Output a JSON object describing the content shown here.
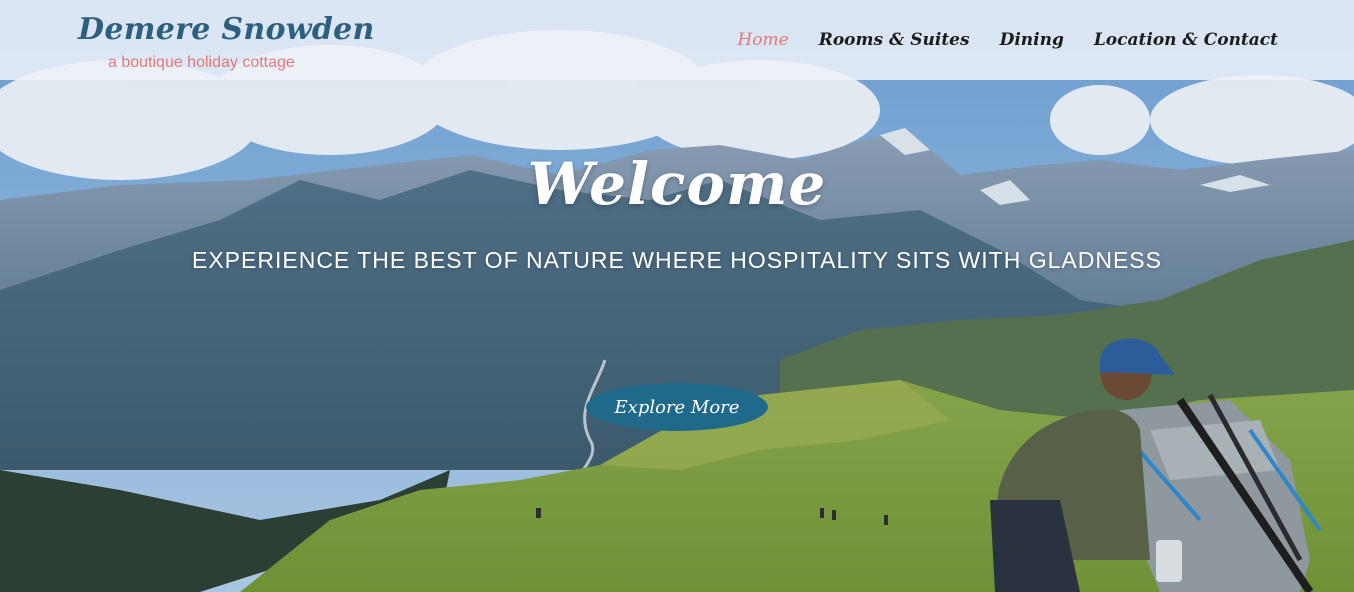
{
  "brand": {
    "name": "Demere Snowden",
    "tagline": "a boutique holiday cottage"
  },
  "nav": {
    "items": [
      {
        "label": "Home",
        "active": true
      },
      {
        "label": "Rooms & Suites",
        "active": false
      },
      {
        "label": "Dining",
        "active": false
      },
      {
        "label": "Location & Contact",
        "active": false
      }
    ]
  },
  "hero": {
    "heading": "Welcome",
    "subheading": "EXPERIENCE THE BEST OF NATURE WHERE HOSPITALITY SITS WITH GLADNESS",
    "cta_label": "Explore More",
    "image": "mountain-landscape-with-hiker"
  },
  "colors": {
    "brand": "#2e5f7f",
    "accent": "#e07a7a",
    "button": "#1f6a8a"
  }
}
